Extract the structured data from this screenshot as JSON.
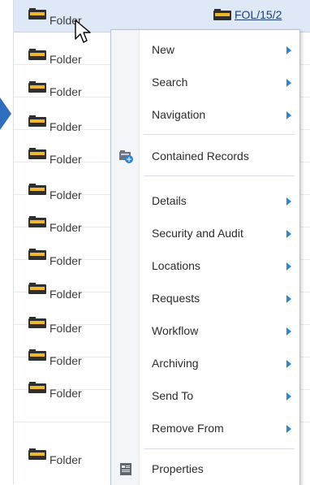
{
  "rows": [
    {
      "label": "Folder",
      "selected": true,
      "ref": "FOL/15/2"
    },
    {
      "label": "Folder"
    },
    {
      "label": "Folder"
    },
    {
      "label": "Folder"
    },
    {
      "label": "Folder"
    },
    {
      "label": "Folder"
    },
    {
      "label": "Folder"
    },
    {
      "label": "Folder"
    },
    {
      "label": "Folder"
    },
    {
      "label": "Folder"
    },
    {
      "label": "Folder"
    },
    {
      "label": "Folder"
    },
    {
      "label": "Folder"
    }
  ],
  "colors": {
    "folder": "#2f2f2f",
    "folder_band": "#f0b92a",
    "selected_row": "#dfe8f6",
    "submenu_arrow": "#2c86d3",
    "indicator": "#2f6fbd"
  },
  "context_menu": {
    "items": [
      {
        "label": "New",
        "submenu": true
      },
      {
        "label": "Search",
        "submenu": true
      },
      {
        "label": "Navigation",
        "submenu": true
      },
      {
        "separator": true
      },
      {
        "label": "Contained Records",
        "submenu": false,
        "icon": "contained-records-icon"
      },
      {
        "separator": true
      },
      {
        "label": "Details",
        "submenu": true
      },
      {
        "label": "Security and Audit",
        "submenu": true
      },
      {
        "label": "Locations",
        "submenu": true
      },
      {
        "label": "Requests",
        "submenu": true
      },
      {
        "label": "Workflow",
        "submenu": true
      },
      {
        "label": "Archiving",
        "submenu": true
      },
      {
        "label": "Send To",
        "submenu": true
      },
      {
        "label": "Remove From",
        "submenu": true
      },
      {
        "separator": true
      },
      {
        "label": "Properties",
        "submenu": false,
        "icon": "properties-icon"
      }
    ]
  }
}
